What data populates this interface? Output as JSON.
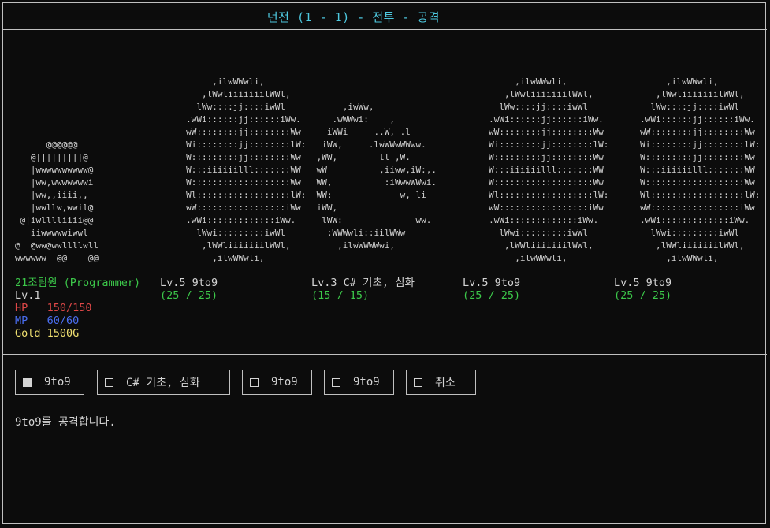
{
  "title": "던전 (1 - 1) - 전투 - 공격",
  "player": {
    "art": "      @@@@@@\n   @|||||||||@\n   |wwwwwwwwww@\n   |ww,wwwwwwwi\n   |ww,,iiii,,\n   |wwllw,wwil@\n @|iwlllliiii@@\n   iiwwwwwiwwl\n@  @ww@wwllllwll\nwwwwww  @@    @@",
    "name": "21조팀원 (Programmer)",
    "level": "Lv.1",
    "hp_label": "HP",
    "hp_value": "150/150",
    "mp_label": "MP",
    "mp_value": "60/60",
    "gold": "Gold 1500G"
  },
  "monsters": [
    {
      "art": "          ,ilwWWwli,\n        ,lWwliiiiiiilWWl,\n       lWw::::jj::::iwWl\n     .wWi::::::jj::::::iWw.\n     wW::::::::jj::::::::Ww\n     Wi::::::::jj::::::::lW:\n     W:::::::::jj::::::::Ww\n     W:::iiiiiilll:::::::WW\n     W:::::::::::::::::::Ww\n     Wl::::::::::::::::::lW:\n     wW:::::::::::::::::iWw\n     .wWi:::::::::::::iWw.\n       lWwi:::::::::iwWl\n        ,lWWliiiiiiilWWl,\n          ,ilwWWwli,",
      "name": "Lv.5 9to9",
      "hp": "(25 / 25)"
    },
    {
      "art": "\n\n      ,iwWw,\n    .wWWwi:    ,\n   iWWi     ..W, .l\n  iWW,     .lwWWwWWww.\n ,WW,        ll ,W.\n wW          ,iiww,iW:,.\n WW,          :iWwwWWwi.\n WW:             w, li\n iWW,\n  lWW:              ww.\n   :WWWwli::iilWWw\n     ,ilwWWWWwi,",
      "name": "Lv.3 C# 기초, 심화",
      "hp": "(15 / 15)"
    },
    {
      "art": "          ,ilwWWwli,\n        ,lWwliiiiiiilWWl,\n       lWw::::jj::::iwWl\n     .wWi::::::jj::::::iWw.\n     wW::::::::jj::::::::Ww\n     Wi::::::::jj::::::::lW:\n     W:::::::::jj::::::::Ww\n     W:::iiiiiilll:::::::WW\n     W:::::::::::::::::::Ww\n     Wl::::::::::::::::::lW:\n     wW:::::::::::::::::iWw\n     .wWi:::::::::::::iWw.\n       lWwi:::::::::iwWl\n        ,lWWliiiiiiilWWl,\n          ,ilwWWwli,",
      "name": "Lv.5 9to9",
      "hp": "(25 / 25)"
    },
    {
      "art": "          ,ilwWWwli,\n        ,lWwliiiiiiilWWl,\n       lWw::::jj::::iwWl\n     .wWi::::::jj::::::iWw.\n     wW::::::::jj::::::::Ww\n     Wi::::::::jj::::::::lW:\n     W:::::::::jj::::::::Ww\n     W:::iiiiiilll:::::::WW\n     W:::::::::::::::::::Ww\n     Wl::::::::::::::::::lW:\n     wW:::::::::::::::::iWw\n     .wWi:::::::::::::iWw.\n       lWwi:::::::::iwWl\n        ,lWWliiiiiiilWWl,\n          ,ilwWWwli,",
      "name": "Lv.5 9to9",
      "hp": "(25 / 25)"
    }
  ],
  "options": [
    {
      "label": "9to9",
      "selected": true
    },
    {
      "label": "C# 기초, 심화",
      "selected": false
    },
    {
      "label": "9to9",
      "selected": false
    },
    {
      "label": "9to9",
      "selected": false
    },
    {
      "label": "취소",
      "selected": false
    }
  ],
  "message": "9to9를 공격합니다."
}
